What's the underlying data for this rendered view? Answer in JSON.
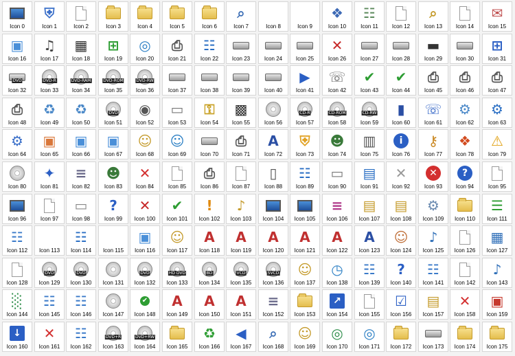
{
  "window": {
    "background": "#f3f3f3",
    "cell_background": "#ffffff",
    "cell_border": "#d6d6d6"
  },
  "icons": [
    {
      "label": "Icon 0",
      "icon": "monitor-icon"
    },
    {
      "label": "Icon 1",
      "icon": "shield-icon"
    },
    {
      "label": "Icon 2",
      "icon": "document-icon"
    },
    {
      "label": "Icon 3",
      "icon": "folder-icon"
    },
    {
      "label": "Icon 4",
      "icon": "folder-icon"
    },
    {
      "label": "Icon 5",
      "icon": "folder-icon"
    },
    {
      "label": "Icon 6",
      "icon": "folder-icon"
    },
    {
      "label": "Icon 7",
      "icon": "magnifier-icon"
    },
    {
      "label": "Icon 8",
      "icon": "blank-icon"
    },
    {
      "label": "Icon 9",
      "icon": "blank-icon"
    },
    {
      "label": "Icon 10",
      "icon": "puzzle-icon"
    },
    {
      "label": "Icon 11",
      "icon": "newspaper-icon"
    },
    {
      "label": "Icon 12",
      "icon": "blank-page-icon"
    },
    {
      "label": "Icon 13",
      "icon": "folder-search-icon"
    },
    {
      "label": "Icon 14",
      "icon": "document-icon"
    },
    {
      "label": "Icon 15",
      "icon": "envelope-icon"
    },
    {
      "label": "Icon 16",
      "icon": "picture-icon"
    },
    {
      "label": "Icon 17",
      "icon": "music-sheet-icon"
    },
    {
      "label": "Icon 18",
      "icon": "film-icon"
    },
    {
      "label": "Icon 19",
      "icon": "windows-logo-icon"
    },
    {
      "label": "Icon 20",
      "icon": "network-globe-icon"
    },
    {
      "label": "Icon 21",
      "icon": "printer-icon"
    },
    {
      "label": "Icon 22",
      "icon": "control-panel-icon"
    },
    {
      "label": "Icon 23",
      "icon": "drive-icon"
    },
    {
      "label": "Icon 24",
      "icon": "drive-icon"
    },
    {
      "label": "Icon 25",
      "icon": "drive-icon"
    },
    {
      "label": "Icon 26",
      "icon": "drive-error-icon"
    },
    {
      "label": "Icon 27",
      "icon": "drive-icon"
    },
    {
      "label": "Icon 28",
      "icon": "drive-icon"
    },
    {
      "label": "Icon 29",
      "icon": "memory-chip-icon"
    },
    {
      "label": "Icon 30",
      "icon": "drive-icon"
    },
    {
      "label": "Icon 31",
      "icon": "windows-drive-icon"
    },
    {
      "label": "Icon 32",
      "icon": "dvd-drive-icon",
      "tag": "DVD"
    },
    {
      "label": "Icon 33",
      "icon": "disc-icon",
      "tag": "DVD-R"
    },
    {
      "label": "Icon 34",
      "icon": "disc-icon",
      "tag": "DVD-RAM"
    },
    {
      "label": "Icon 35",
      "icon": "disc-icon",
      "tag": "DVD-ROM"
    },
    {
      "label": "Icon 36",
      "icon": "disc-icon",
      "tag": "DVD-RW"
    },
    {
      "label": "Icon 37",
      "icon": "drive-icon"
    },
    {
      "label": "Icon 38",
      "icon": "drive-icon"
    },
    {
      "label": "Icon 39",
      "icon": "removable-drive-icon"
    },
    {
      "label": "Icon 40",
      "icon": "network-drive-icon"
    },
    {
      "label": "Icon 41",
      "icon": "media-player-icon"
    },
    {
      "label": "Icon 42",
      "icon": "mobile-phone-icon"
    },
    {
      "label": "Icon 43",
      "icon": "drive-check-icon"
    },
    {
      "label": "Icon 44",
      "icon": "drive-check-icon"
    },
    {
      "label": "Icon 45",
      "icon": "printer-icon"
    },
    {
      "label": "Icon 46",
      "icon": "printer-icon"
    },
    {
      "label": "Icon 47",
      "icon": "printer-icon"
    },
    {
      "label": "Icon 48",
      "icon": "printer-icon"
    },
    {
      "label": "Icon 49",
      "icon": "recycle-bin-icon"
    },
    {
      "label": "Icon 50",
      "icon": "recycle-bin-icon"
    },
    {
      "label": "Icon 51",
      "icon": "disc-icon",
      "tag": "DVD"
    },
    {
      "label": "Icon 52",
      "icon": "camera-icon"
    },
    {
      "label": "Icon 53",
      "icon": "scanner-icon"
    },
    {
      "label": "Icon 54",
      "icon": "padlock-icon"
    },
    {
      "label": "Icon 55",
      "icon": "memory-card-icon"
    },
    {
      "label": "Icon 56",
      "icon": "disc-icon"
    },
    {
      "label": "Icon 57",
      "icon": "disc-icon",
      "tag": "CD-R"
    },
    {
      "label": "Icon 58",
      "icon": "disc-icon",
      "tag": "CD-ROM"
    },
    {
      "label": "Icon 59",
      "icon": "disc-icon",
      "tag": "CD-RW"
    },
    {
      "label": "Icon 60",
      "icon": "book-icon"
    },
    {
      "label": "Icon 61",
      "icon": "webcam-phone-icon"
    },
    {
      "label": "Icon 62",
      "icon": "settings-document-icon"
    },
    {
      "label": "Icon 63",
      "icon": "settings-window-icon"
    },
    {
      "label": "Icon 64",
      "icon": "gear-icon"
    },
    {
      "label": "Icon 65",
      "icon": "image-document-icon"
    },
    {
      "label": "Icon 66",
      "icon": "picture-icon"
    },
    {
      "label": "Icon 67",
      "icon": "picture-icon"
    },
    {
      "label": "Icon 68",
      "icon": "user-folder-icon"
    },
    {
      "label": "Icon 69",
      "icon": "network-user-icon"
    },
    {
      "label": "Icon 70",
      "icon": "drive-icon"
    },
    {
      "label": "Icon 71",
      "icon": "printer-icon"
    },
    {
      "label": "Icon 72",
      "icon": "font-folder-icon"
    },
    {
      "label": "Icon 73",
      "icon": "security-shield-icon"
    },
    {
      "label": "Icon 74",
      "icon": "users-icon"
    },
    {
      "label": "Icon 75",
      "icon": "server-icon"
    },
    {
      "label": "Icon 76",
      "icon": "info-icon"
    },
    {
      "label": "Icon 77",
      "icon": "key-icon"
    },
    {
      "label": "Icon 78",
      "icon": "puzzle-folder-icon"
    },
    {
      "label": "Icon 79",
      "icon": "warning-icon"
    },
    {
      "label": "Icon 80",
      "icon": "disc-icon"
    },
    {
      "label": "Icon 81",
      "icon": "compass-icon"
    },
    {
      "label": "Icon 82",
      "icon": "library-icon"
    },
    {
      "label": "Icon 83",
      "icon": "users-icon"
    },
    {
      "label": "Icon 84",
      "icon": "red-x-icon"
    },
    {
      "label": "Icon 85",
      "icon": "document-icon"
    },
    {
      "label": "Icon 86",
      "icon": "printer-icon"
    },
    {
      "label": "Icon 87",
      "icon": "document-icon"
    },
    {
      "label": "Icon 88",
      "icon": "tablet-icon"
    },
    {
      "label": "Icon 89",
      "icon": "network-icon"
    },
    {
      "label": "Icon 90",
      "icon": "scanner-icon"
    },
    {
      "label": "Icon 91",
      "icon": "window-icon"
    },
    {
      "label": "Icon 92",
      "icon": "gray-x-icon"
    },
    {
      "label": "Icon 93",
      "icon": "error-icon"
    },
    {
      "label": "Icon 94",
      "icon": "help-icon"
    },
    {
      "label": "Icon 95",
      "icon": "document-icon"
    },
    {
      "label": "Icon 96",
      "icon": "monitor-icon"
    },
    {
      "label": "Icon 97",
      "icon": "document-icon"
    },
    {
      "label": "Icon 98",
      "icon": "projector-screen-icon"
    },
    {
      "label": "Icon 99",
      "icon": "help-shield-icon"
    },
    {
      "label": "Icon 100",
      "icon": "error-shield-icon"
    },
    {
      "label": "Icon 101",
      "icon": "check-shield-icon"
    },
    {
      "label": "Icon 102",
      "icon": "warning-shield-icon"
    },
    {
      "label": "Icon 103",
      "icon": "music-folder-icon"
    },
    {
      "label": "Icon 104",
      "icon": "computer-icon"
    },
    {
      "label": "Icon 105",
      "icon": "monitor-icon"
    },
    {
      "label": "Icon 106",
      "icon": "books-icon"
    },
    {
      "label": "Icon 107",
      "icon": "document-folder-icon"
    },
    {
      "label": "Icon 108",
      "icon": "document-folder-icon"
    },
    {
      "label": "Icon 109",
      "icon": "settings-folder-icon"
    },
    {
      "label": "Icon 110",
      "icon": "folder-icon"
    },
    {
      "label": "Icon 111",
      "icon": "list-document-icon"
    },
    {
      "label": "Icon 112",
      "icon": "network-computer-icon"
    },
    {
      "label": "Icon 113",
      "icon": "blank-icon"
    },
    {
      "label": "Icon 114",
      "icon": "network-icon"
    },
    {
      "label": "Icon 115",
      "icon": "blank-icon"
    },
    {
      "label": "Icon 116",
      "icon": "picture-icon"
    },
    {
      "label": "Icon 117",
      "icon": "user-folder-icon"
    },
    {
      "label": "Icon 118",
      "icon": "font-document-icon"
    },
    {
      "label": "Icon 119",
      "icon": "font-document-icon"
    },
    {
      "label": "Icon 120",
      "icon": "font-document-icon"
    },
    {
      "label": "Icon 121",
      "icon": "font-document-icon"
    },
    {
      "label": "Icon 122",
      "icon": "font-document-icon"
    },
    {
      "label": "Icon 123",
      "icon": "font-folder-icon"
    },
    {
      "label": "Icon 124",
      "icon": "user-icon"
    },
    {
      "label": "Icon 125",
      "icon": "music-document-icon"
    },
    {
      "label": "Icon 126",
      "icon": "document-icon"
    },
    {
      "label": "Icon 127",
      "icon": "video-document-icon"
    },
    {
      "label": "Icon 128",
      "icon": "document-icon"
    },
    {
      "label": "Icon 129",
      "icon": "disc-icon",
      "tag": "DVD"
    },
    {
      "label": "Icon 130",
      "icon": "disc-icon",
      "tag": "DVD"
    },
    {
      "label": "Icon 131",
      "icon": "disc-icon"
    },
    {
      "label": "Icon 132",
      "icon": "disc-icon",
      "tag": "DVD"
    },
    {
      "label": "Icon 133",
      "icon": "disc-icon",
      "tag": "HD DVD"
    },
    {
      "label": "Icon 134",
      "icon": "disc-icon",
      "tag": "BD"
    },
    {
      "label": "Icon 135",
      "icon": "disc-icon",
      "tag": "VCD"
    },
    {
      "label": "Icon 136",
      "icon": "disc-icon",
      "tag": "SVCD"
    },
    {
      "label": "Icon 137",
      "icon": "user-folder-icon"
    },
    {
      "label": "Icon 138",
      "icon": "globe-clock-icon"
    },
    {
      "label": "Icon 139",
      "icon": "network-computer-icon"
    },
    {
      "label": "Icon 140",
      "icon": "help-computer-icon"
    },
    {
      "label": "Icon 141",
      "icon": "network-computer-icon"
    },
    {
      "label": "Icon 142",
      "icon": "document-icon"
    },
    {
      "label": "Icon 143",
      "icon": "music-document-icon"
    },
    {
      "label": "Icon 144",
      "icon": "chart-monitor-icon"
    },
    {
      "label": "Icon 145",
      "icon": "network-computer-icon"
    },
    {
      "label": "Icon 146",
      "icon": "network-computer-icon"
    },
    {
      "label": "Icon 147",
      "icon": "disc-icon"
    },
    {
      "label": "Icon 148",
      "icon": "check-icon"
    },
    {
      "label": "Icon 149",
      "icon": "font-document-icon"
    },
    {
      "label": "Icon 150",
      "icon": "font-document-icon"
    },
    {
      "label": "Icon 151",
      "icon": "font-document-icon"
    },
    {
      "label": "Icon 152",
      "icon": "library-icon"
    },
    {
      "label": "Icon 153",
      "icon": "folder-icon"
    },
    {
      "label": "Icon 154",
      "icon": "shortcut-arrow-icon"
    },
    {
      "label": "Icon 155",
      "icon": "document-icon"
    },
    {
      "label": "Icon 156",
      "icon": "checklist-icon"
    },
    {
      "label": "Icon 157",
      "icon": "document-folder-icon"
    },
    {
      "label": "Icon 158",
      "icon": "network-error-icon"
    },
    {
      "label": "Icon 159",
      "icon": "photo-document-icon"
    },
    {
      "label": "Icon 160",
      "icon": "download-arrow-icon"
    },
    {
      "label": "Icon 161",
      "icon": "red-x-icon"
    },
    {
      "label": "Icon 162",
      "icon": "network-computer-icon"
    },
    {
      "label": "Icon 163",
      "icon": "disc-icon",
      "tag": "DVD+R"
    },
    {
      "label": "Icon 164",
      "icon": "disc-icon",
      "tag": "DVD+RW"
    },
    {
      "label": "Icon 165",
      "icon": "folder-icon"
    },
    {
      "label": "Icon 166",
      "icon": "recycle-document-icon"
    },
    {
      "label": "Icon 167",
      "icon": "speaker-document-icon"
    },
    {
      "label": "Icon 168",
      "icon": "magnifier-icon"
    },
    {
      "label": "Icon 169",
      "icon": "user-folder-icon"
    },
    {
      "label": "Icon 170",
      "icon": "globe-icon"
    },
    {
      "label": "Icon 171",
      "icon": "network-globe-icon"
    },
    {
      "label": "Icon 172",
      "icon": "folder-icon"
    },
    {
      "label": "Icon 173",
      "icon": "drive-icon"
    },
    {
      "label": "Icon 174",
      "icon": "folder-icon"
    },
    {
      "label": "Icon 175",
      "icon": "folder-icon"
    }
  ]
}
